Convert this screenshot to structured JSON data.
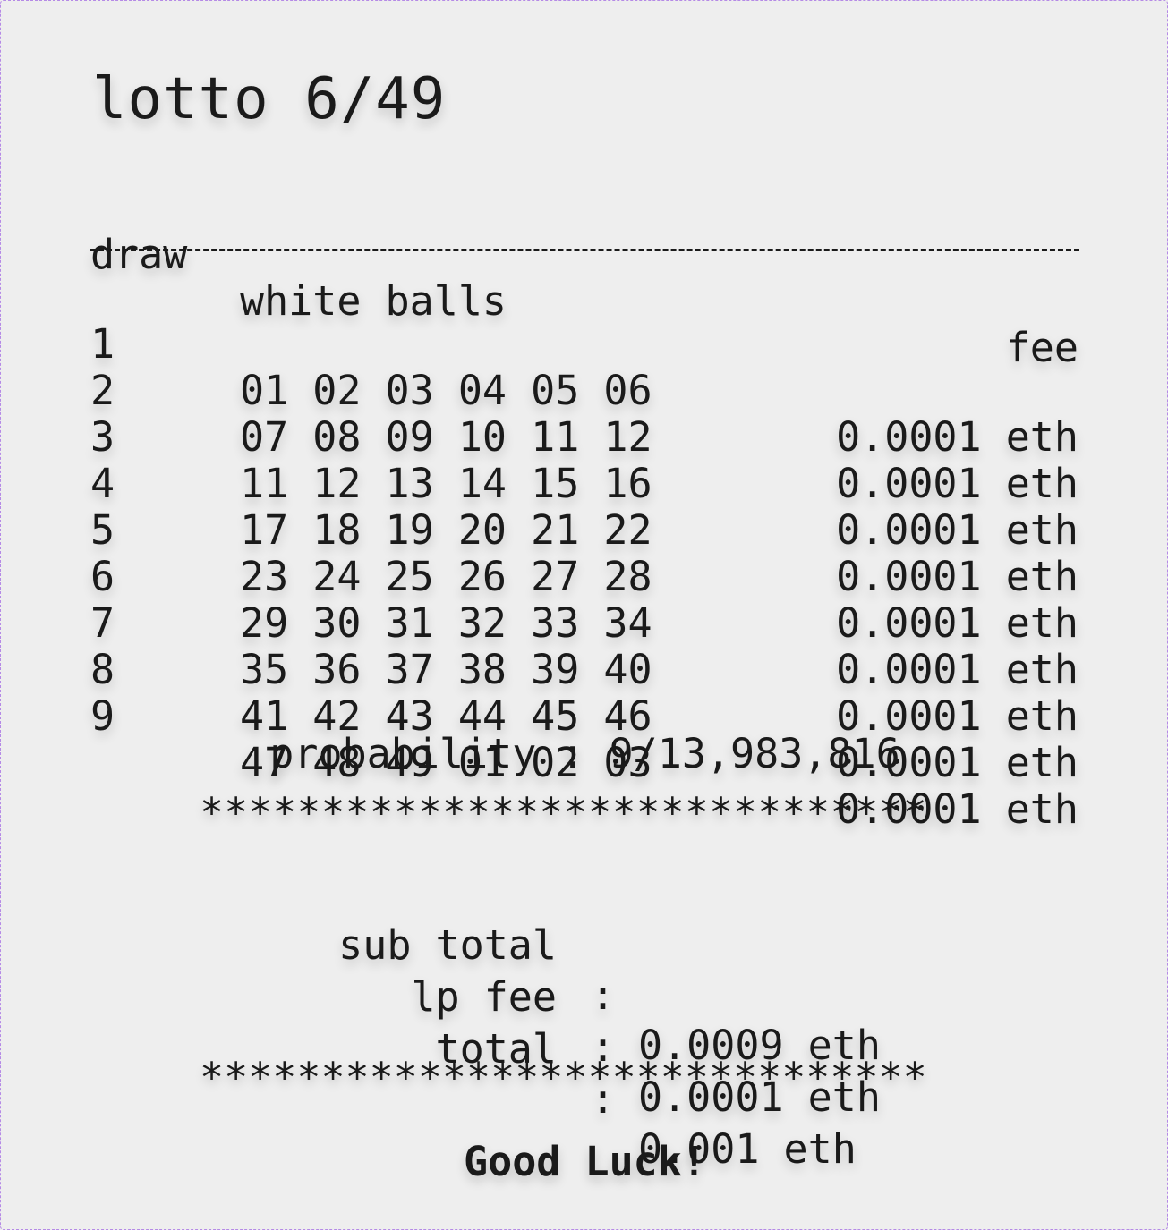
{
  "title": "lotto 6/49",
  "headers": {
    "draw": "draw",
    "balls": "white balls",
    "fee": "fee"
  },
  "draws": [
    {
      "draw": "1",
      "balls": "01 02 03 04 05 06",
      "fee": "0.0001 eth"
    },
    {
      "draw": "2",
      "balls": "07 08 09 10 11 12",
      "fee": "0.0001 eth"
    },
    {
      "draw": "3",
      "balls": "11 12 13 14 15 16",
      "fee": "0.0001 eth"
    },
    {
      "draw": "4",
      "balls": "17 18 19 20 21 22",
      "fee": "0.0001 eth"
    },
    {
      "draw": "5",
      "balls": "23 24 25 26 27 28",
      "fee": "0.0001 eth"
    },
    {
      "draw": "6",
      "balls": "29 30 31 32 33 34",
      "fee": "0.0001 eth"
    },
    {
      "draw": "7",
      "balls": "35 36 37 38 39 40",
      "fee": "0.0001 eth"
    },
    {
      "draw": "8",
      "balls": "41 42 43 44 45 46",
      "fee": "0.0001 eth"
    },
    {
      "draw": "9",
      "balls": "47 48 49 01 02 03",
      "fee": "0.0001 eth"
    }
  ],
  "probability": "probability : 9/13,983,816",
  "stars": "******************************",
  "summary": [
    {
      "label": "sub total",
      "colon": ":",
      "value": "0.0009 eth"
    },
    {
      "label": "lp fee",
      "colon": ":",
      "value": "0.0001 eth"
    },
    {
      "label": "total",
      "colon": ":",
      "value": "0.001 eth"
    }
  ],
  "footer": "Good Luck!"
}
